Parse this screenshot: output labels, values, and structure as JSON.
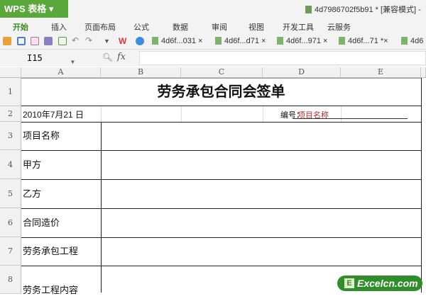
{
  "app": {
    "name": "WPS 表格",
    "doc_title": "4d7986702f5b91 * [兼容模式] -"
  },
  "ribbon_tabs": [
    "开始",
    "插入",
    "页面布局",
    "公式",
    "数据",
    "审阅",
    "视图",
    "开发工具",
    "云服务"
  ],
  "file_tabs": [
    "4d6f...031 ×",
    "4d6f...d71 ×",
    "4d6f...971 ×",
    "4d6f...71 *×",
    "4d6"
  ],
  "formula_bar": {
    "name_box": "I15",
    "fx": "fx",
    "value": ""
  },
  "columns": [
    "A",
    "B",
    "C",
    "D",
    "E"
  ],
  "rows": [
    "1",
    "2",
    "3",
    "4",
    "5",
    "6",
    "7",
    "8"
  ],
  "sheet": {
    "title": "劳务承包合同会签单",
    "date": "2010年7月21 日",
    "number_label": "编号：",
    "number_value": "项目名称",
    "labels": [
      "项目名称",
      "甲方",
      "乙方",
      "合同造价",
      "劳务承包工程",
      "劳务工程内容"
    ]
  },
  "watermark": "Excelcn.com",
  "colors": {
    "accent": "#5aa83a",
    "red_text": "#b03030"
  }
}
